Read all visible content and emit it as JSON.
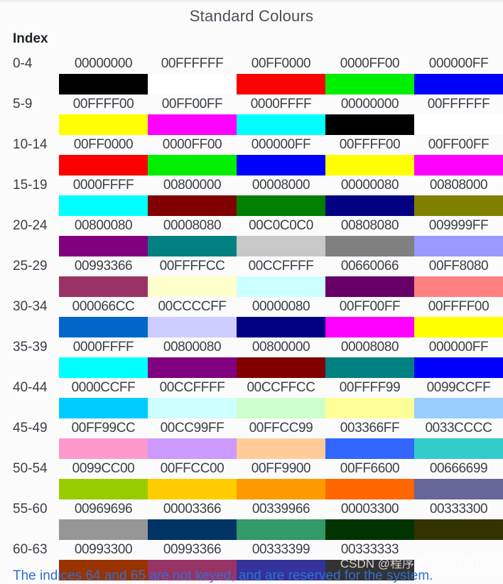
{
  "title": "Standard Colours",
  "index_header": "Index",
  "watermark": "CSDN @程序猿与金融与科技",
  "footer_note": "The indices 64 and 65 are not keyed, and are reserved for the system.",
  "table": {
    "rows": [
      {
        "index_label": "0-4",
        "hex": [
          "00000000",
          "00FFFFFF",
          "00FF0000",
          "0000FF00",
          "000000FF"
        ],
        "swatches": [
          "#000000",
          "#ffffff",
          "#ff0000",
          "#00ef00",
          "#0000ff"
        ]
      },
      {
        "index_label": "5-9",
        "hex": [
          "00FFFF00",
          "00FF00FF",
          "0000FFFF",
          "00000000",
          "00FFFFFF"
        ],
        "swatches": [
          "#ffff00",
          "#ff00ff",
          "#00ffff",
          "#000000",
          "#ffffff"
        ]
      },
      {
        "index_label": "10-14",
        "hex": [
          "00FF0000",
          "0000FF00",
          "000000FF",
          "00FFFF00",
          "00FF00FF"
        ],
        "swatches": [
          "#ff0000",
          "#00ef00",
          "#0000ff",
          "#ffff00",
          "#ff00ff"
        ]
      },
      {
        "index_label": "15-19",
        "hex": [
          "0000FFFF",
          "00800000",
          "00008000",
          "00000080",
          "00808000"
        ],
        "swatches": [
          "#00ffff",
          "#800000",
          "#007f00",
          "#000080",
          "#808000"
        ]
      },
      {
        "index_label": "20-24",
        "hex": [
          "00800080",
          "00008080",
          "00C0C0C0",
          "00808080",
          "009999FF"
        ],
        "swatches": [
          "#800080",
          "#008080",
          "#c8c8c8",
          "#808080",
          "#9999ff"
        ]
      },
      {
        "index_label": "25-29",
        "hex": [
          "00993366",
          "00FFFFCC",
          "00CCFFFF",
          "00660066",
          "00FF8080"
        ],
        "swatches": [
          "#993366",
          "#ffffcc",
          "#ccffff",
          "#660066",
          "#ff8080"
        ]
      },
      {
        "index_label": "30-34",
        "hex": [
          "000066CC",
          "00CCCCFF",
          "00000080",
          "00FF00FF",
          "00FFFF00"
        ],
        "swatches": [
          "#0066cc",
          "#ccccff",
          "#000080",
          "#ff00ff",
          "#ffff00"
        ]
      },
      {
        "index_label": "35-39",
        "hex": [
          "0000FFFF",
          "00800080",
          "00800000",
          "00008080",
          "000000FF"
        ],
        "swatches": [
          "#00ffff",
          "#800080",
          "#800000",
          "#008080",
          "#0000ff"
        ]
      },
      {
        "index_label": "40-44",
        "hex": [
          "0000CCFF",
          "00CCFFFF",
          "00CCFFCC",
          "00FFFF99",
          "0099CCFF"
        ],
        "swatches": [
          "#00ccff",
          "#ccffff",
          "#ccffcc",
          "#ffff99",
          "#99ccff"
        ]
      },
      {
        "index_label": "45-49",
        "hex": [
          "00FF99CC",
          "00CC99FF",
          "00FFCC99",
          "003366FF",
          "0033CCCC"
        ],
        "swatches": [
          "#ff99cc",
          "#cc99ff",
          "#ffcc99",
          "#3366ff",
          "#33cccc"
        ]
      },
      {
        "index_label": "50-54",
        "hex": [
          "0099CC00",
          "00FFCC00",
          "00FF9900",
          "00FF6600",
          "00666699"
        ],
        "swatches": [
          "#99cc00",
          "#ffcc00",
          "#ff9900",
          "#ff6600",
          "#666699"
        ]
      },
      {
        "index_label": "55-60",
        "hex": [
          "00969696",
          "00003366",
          "00339966",
          "00003300",
          "00333300"
        ],
        "swatches": [
          "#969696",
          "#003366",
          "#339966",
          "#003300",
          "#333300"
        ]
      },
      {
        "index_label": "60-63",
        "hex": [
          "00993300",
          "00993366",
          "00333399",
          "00333333",
          ""
        ],
        "swatches": [
          "#993300",
          "#993366",
          "#333399",
          "#333333",
          ""
        ]
      }
    ]
  }
}
